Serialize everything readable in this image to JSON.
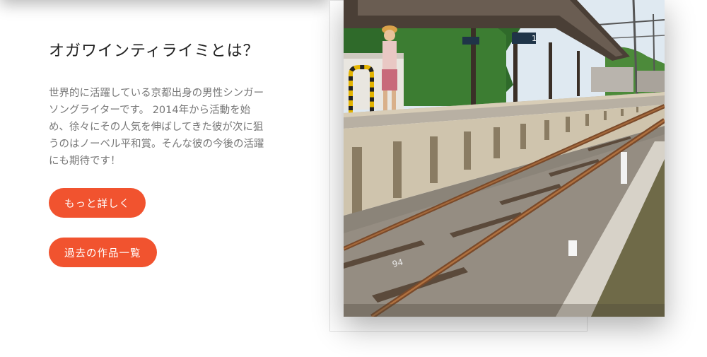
{
  "section": {
    "heading": "オガワインティライミとは？",
    "description": "世界的に活躍している京都出身の男性シンガーソングライターです。 2014年から活動を始め、徐々にその人気を伸ばしてきた彼が次に狙うのはノーベル平和賞。そんな彼の今後の活躍にも期待です！",
    "buttons": {
      "more_label": "もっと詳しく",
      "works_label": "過去の作品一覧"
    }
  },
  "photo": {
    "station_sign_number": "1",
    "sleeper_number": "94"
  },
  "colors": {
    "accent": "#f1532f",
    "heading_text": "#222222",
    "body_text": "#777777"
  }
}
